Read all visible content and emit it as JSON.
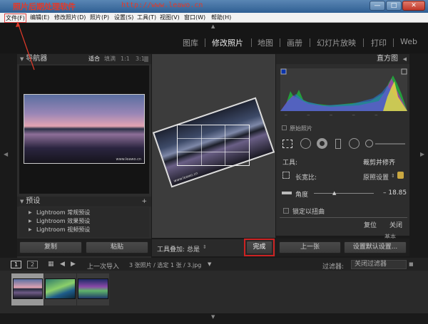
{
  "window": {
    "annotation_title": "照片后期处理软件",
    "annotation_url": "http://www.leawo.cn",
    "minimize": "—",
    "maximize": "□",
    "close": "✕"
  },
  "menu": [
    "文件(F)",
    "编辑(E)",
    "修改照片(D)",
    "照片(P)",
    "设置(S)",
    "工具(T)",
    "视图(V)",
    "窗口(W)",
    "帮助(H)"
  ],
  "modules": [
    {
      "label": "图库"
    },
    {
      "label": "修改照片",
      "active": true
    },
    {
      "label": "地图"
    },
    {
      "label": "画册"
    },
    {
      "label": "幻灯片放映"
    },
    {
      "label": "打印"
    },
    {
      "label": "Web"
    }
  ],
  "navigator": {
    "title": "导航器",
    "opts": [
      "适合",
      "填满",
      "1:1",
      "3:1"
    ],
    "preview_caption": "www.leawo.cn"
  },
  "presets": {
    "title": "预设",
    "add": "+",
    "items": [
      "Lightroom 常规预设",
      "Lightroom 效果预设",
      "Lightroom 视频预设"
    ]
  },
  "left_buttons": {
    "copy": "复制",
    "paste": "粘贴"
  },
  "histogram": {
    "title": "直方图",
    "original_photo": "原始照片"
  },
  "crop": {
    "tool_label": "工具:",
    "tool_value": "裁剪并修齐",
    "aspect_label": "长宽比:",
    "aspect_value": "原照设置",
    "angle_label": "角度",
    "angle_value": "– 18.85",
    "constrain_label": "锁定以扭曲",
    "reset": "复位",
    "close": "关闭",
    "more": "基本"
  },
  "toolbar": {
    "overlay_label": "工具叠加:",
    "overlay_value": "总是",
    "done": "完成",
    "previous": "上一张",
    "reset_settings": "设置默认设置..."
  },
  "filmstrip": {
    "page1": "1",
    "page2": "2",
    "source": "上一次导入",
    "count": "3 张照片 / 选定 1 张 / 3.jpg",
    "filter_label": "过滤器:",
    "filter_value": "关闭过滤器"
  },
  "image_caption": "www.leawo.cn",
  "colors": {
    "accent": "#e23a2a",
    "done_border": "#cc2222"
  }
}
